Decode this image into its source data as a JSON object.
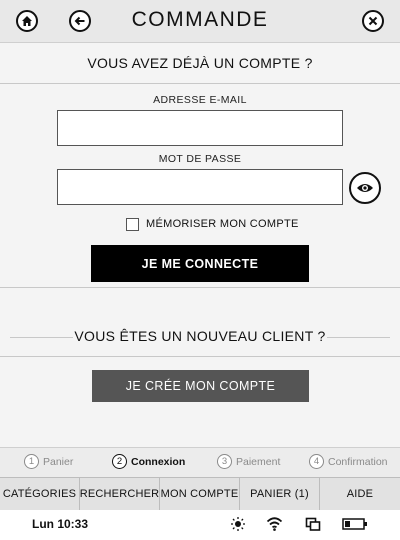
{
  "header": {
    "title": "COMMANDE"
  },
  "login": {
    "title": "VOUS AVEZ DÉJÀ UN COMPTE ?",
    "email_label": "ADRESSE E-MAIL",
    "email_value": "",
    "password_label": "MOT DE PASSE",
    "password_value": "",
    "remember_label": "MÉMORISER MON COMPTE",
    "submit_label": "JE ME CONNECTE"
  },
  "new_client": {
    "title": "VOUS ÊTES UN NOUVEAU CLIENT ?",
    "create_label": "JE CRÉE MON COMPTE"
  },
  "steps": [
    {
      "num": "1",
      "label": "Panier",
      "active": false
    },
    {
      "num": "2",
      "label": "Connexion",
      "active": true
    },
    {
      "num": "3",
      "label": "Paiement",
      "active": false
    },
    {
      "num": "4",
      "label": "Confirmation",
      "active": false
    }
  ],
  "nav": [
    {
      "label": "CATÉGORIES"
    },
    {
      "label": "RECHERCHER"
    },
    {
      "label": "MON COMPTE"
    },
    {
      "label": "PANIER (1)"
    },
    {
      "label": "AIDE"
    }
  ],
  "status": {
    "time": "Lun 10:33"
  }
}
